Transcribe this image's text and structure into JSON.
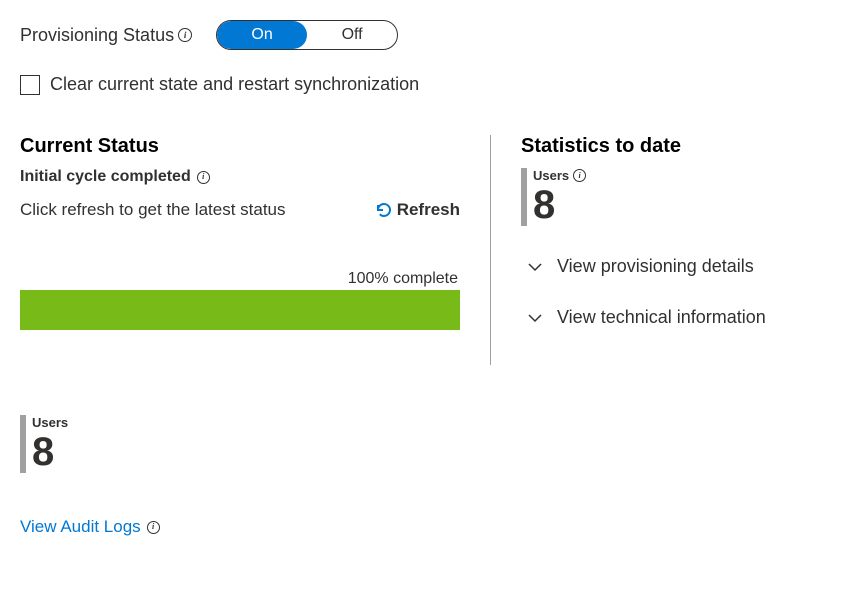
{
  "provisioningStatus": {
    "label": "Provisioning Status",
    "on": "On",
    "off": "Off",
    "activeValue": "On"
  },
  "clearState": {
    "label": "Clear current state and restart synchronization",
    "checked": false
  },
  "currentStatus": {
    "heading": "Current Status",
    "cycleLine": "Initial cycle completed",
    "refreshHint": "Click refresh to get the latest status",
    "refreshButton": "Refresh",
    "progressLabel": "100% complete",
    "progressPercent": 100
  },
  "statistics": {
    "heading": "Statistics to date",
    "usersLabel": "Users",
    "usersValue": "8",
    "expand1": "View provisioning details",
    "expand2": "View technical information"
  },
  "bottomStat": {
    "label": "Users",
    "value": "8"
  },
  "auditLink": "View Audit Logs"
}
